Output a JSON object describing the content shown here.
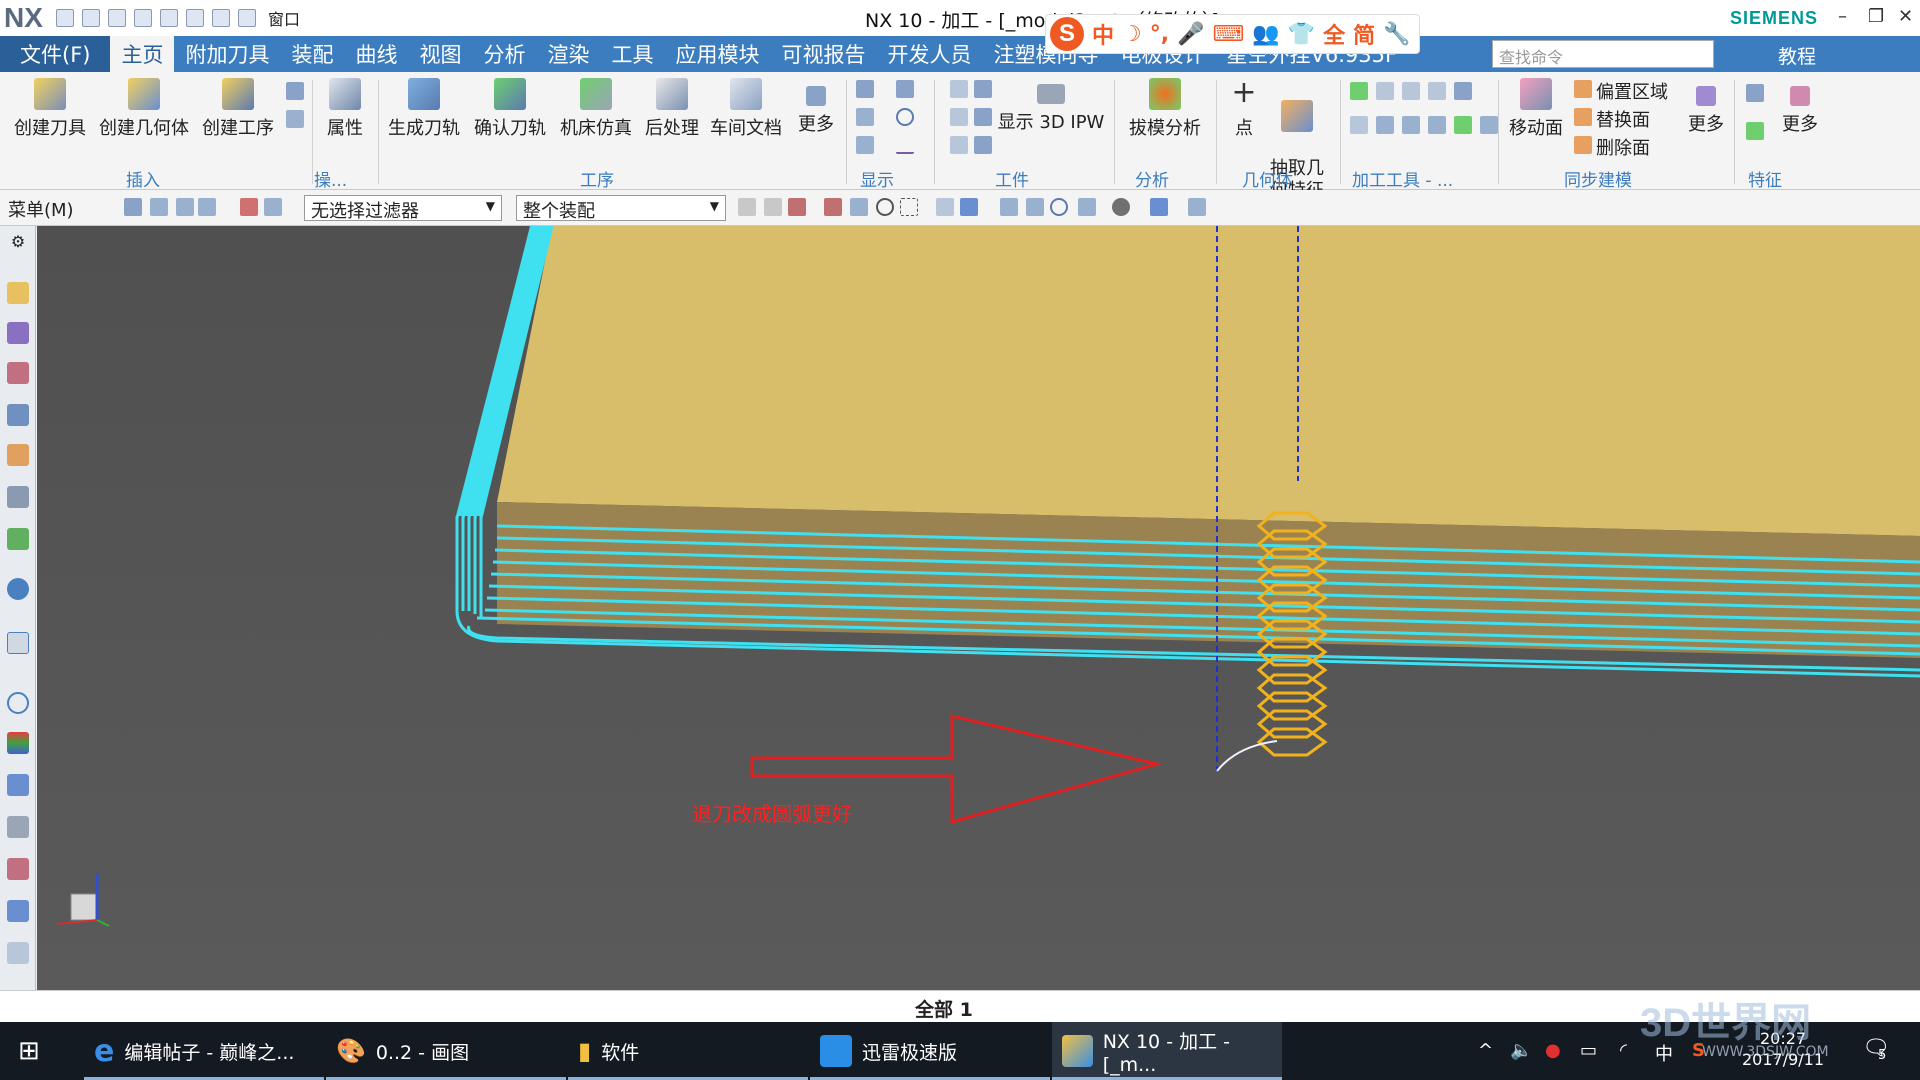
{
  "titlebar": {
    "logo": "NX",
    "window_menu": "窗口",
    "title": "NX 10 - 加工 - [_model2.prt （修改的）]",
    "brand": "SIEMENS",
    "minimize": "–",
    "restore": "❐",
    "close": "✕"
  },
  "ime": {
    "logo": "S",
    "mode": "中",
    "simp": "简",
    "full": "全"
  },
  "menu": {
    "file": "文件(F)",
    "tabs": [
      "主页",
      "附加刀具",
      "装配",
      "曲线",
      "视图",
      "分析",
      "渲染",
      "工具",
      "应用模块",
      "可视报告",
      "开发人员",
      "注塑模向导",
      "电极设计",
      "星空外挂V6.935F"
    ],
    "search_placeholder": "查找命令",
    "tutorial": "教程"
  },
  "ribbon": {
    "buttons": {
      "create_tool": "创建刀具",
      "create_geometry": "创建几何体",
      "create_operation": "创建工序",
      "properties": "属性",
      "generate_toolpath": "生成刀轨",
      "verify_toolpath": "确认刀轨",
      "machine_sim": "机床仿真",
      "post_process": "后处理",
      "shop_doc": "车间文档",
      "more1": "更多",
      "show_ipw": "显示 3D IPW",
      "draft_analysis": "拔模分析",
      "point": "点",
      "extract_geom": "抽取几\n何特征",
      "move_face": "移动面",
      "offset_region": "偏置区域",
      "replace_face": "替换面",
      "delete_face": "删除面",
      "more2": "更多",
      "more3": "更多"
    },
    "groups": {
      "insert": "插入",
      "ops": "操...",
      "operation": "工序",
      "display": "显示",
      "workpiece": "工件",
      "analysis": "分析",
      "geometry": "几何体",
      "machining_tools": "加工工具 - ...",
      "sync_model": "同步建模",
      "feature": "特征"
    }
  },
  "selbar": {
    "menu": "菜单(M)",
    "filter": "无选择过滤器",
    "scope": "整个装配"
  },
  "viewport": {
    "annotation": "退刀改成圆弧更好",
    "colors": {
      "stock": "#d8bd6a",
      "stock_side": "#9a8350",
      "toolpath": "#3fe0f0",
      "helix": "#f2b21b",
      "arrow": "#e02020"
    }
  },
  "status": {
    "text": "全部 1"
  },
  "taskbar": {
    "items": [
      {
        "label": "编辑帖子 - 巅峰之..."
      },
      {
        "label": "0..2 - 画图"
      },
      {
        "label": "软件"
      },
      {
        "label": "迅雷极速版"
      },
      {
        "label": "NX 10 - 加工 - [_m..."
      }
    ],
    "ime": "中",
    "time": "20:27",
    "date": "2017/9/11",
    "notifications": "5"
  },
  "watermark": {
    "logo": "3D世界网",
    "url": "WWW.3DSJW.COM"
  }
}
